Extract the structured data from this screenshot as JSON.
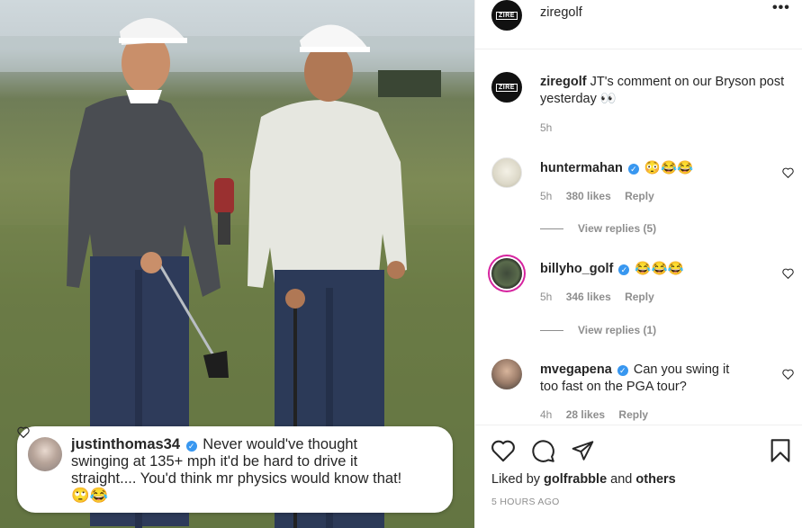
{
  "photo": {
    "alt": "",
    "comment": {
      "username": "justinthomas34",
      "verified": true,
      "text": "Never would've thought swinging at 135+ mph it'd be hard to drive it straight.... You'd think mr physics would know that! 🙄😂"
    }
  },
  "header": {
    "avatar_text": "ZIRE",
    "username": "ziregolf",
    "more": "•••"
  },
  "caption": {
    "avatar_text": "ZIRE",
    "username": "ziregolf",
    "text": "JT's comment on our Bryson post yesterday 👀",
    "time": "5h"
  },
  "comments": [
    {
      "username": "huntermahan",
      "verified": true,
      "text": "😳😂😂",
      "time": "5h",
      "likes": "380 likes",
      "reply": "Reply",
      "view_replies": "View replies (5)"
    },
    {
      "username": "billyho_golf",
      "verified": true,
      "text": "😂😂😂",
      "time": "5h",
      "likes": "346 likes",
      "reply": "Reply",
      "view_replies": "View replies (1)"
    },
    {
      "username": "mvegapena",
      "verified": true,
      "text": "Can you swing it too fast on the PGA tour?",
      "time": "4h",
      "likes": "28 likes",
      "reply": "Reply"
    }
  ],
  "actions": {
    "liked_by_prefix": "Liked by",
    "liked_by_user": "golfrabble",
    "liked_and": "and",
    "liked_others": "others",
    "time_ago": "5 HOURS AGO"
  },
  "colors": {
    "verified": "#3897f0",
    "secondary_text": "#8e8e8e",
    "primary_text": "#262626"
  }
}
